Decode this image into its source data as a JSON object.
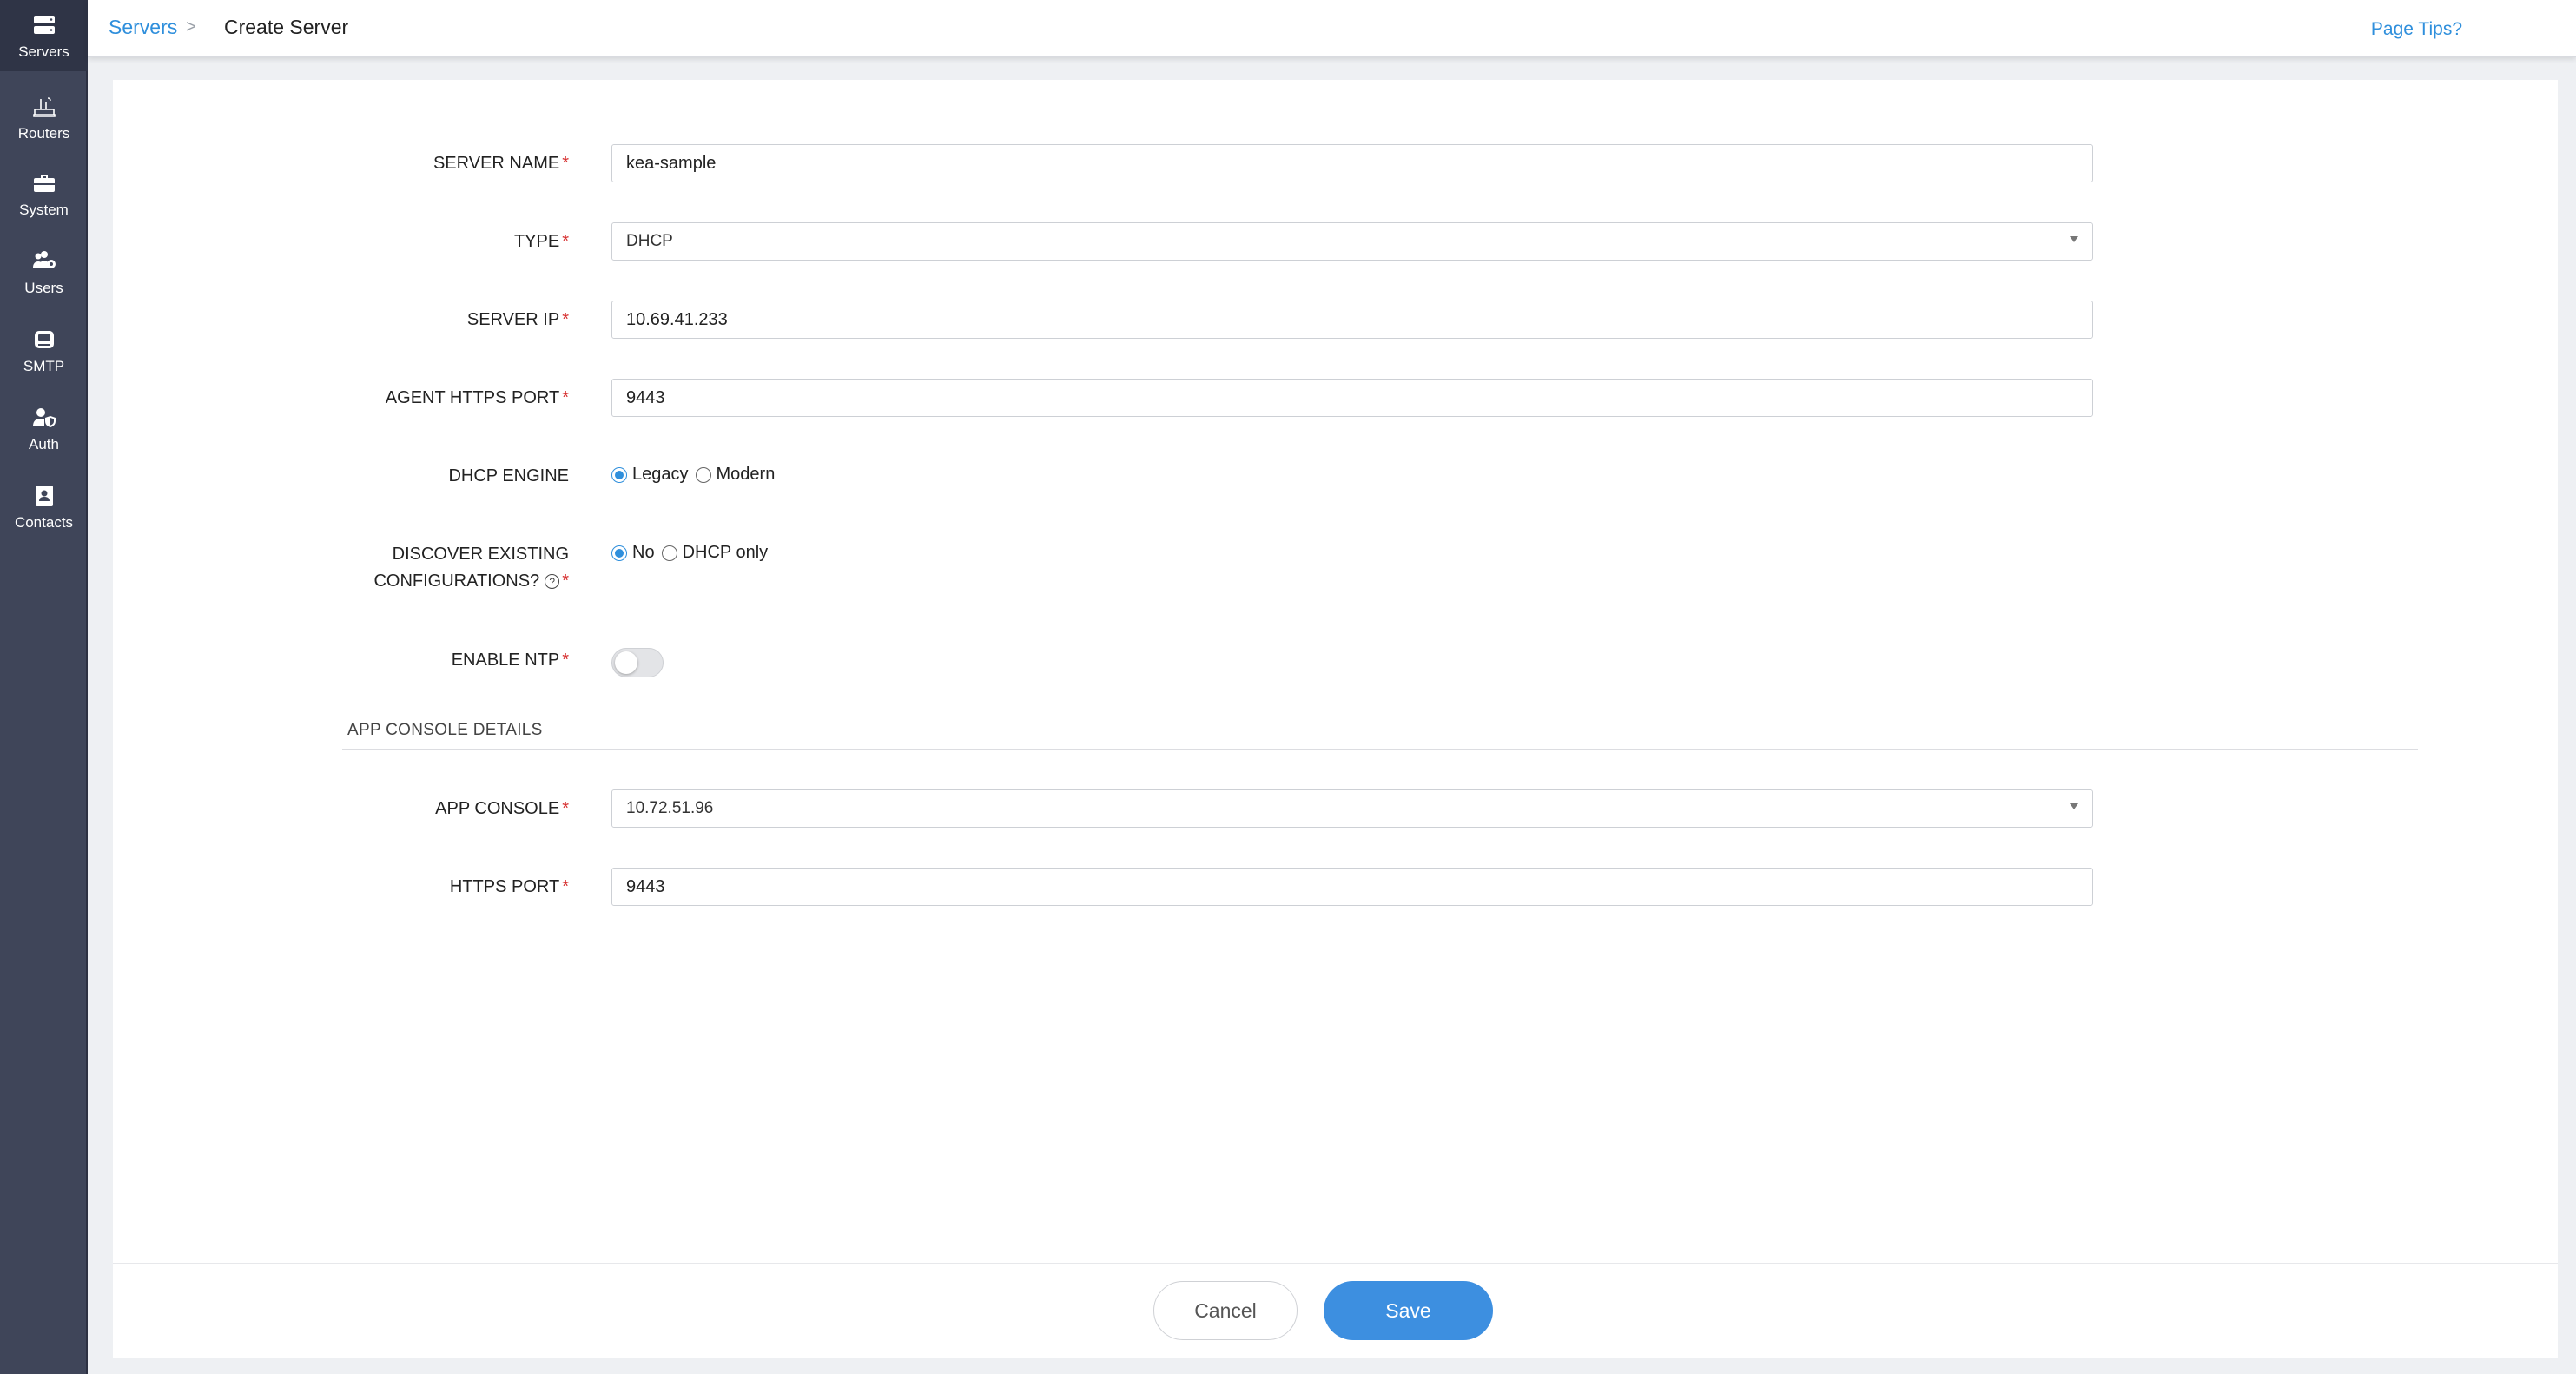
{
  "sidebar": {
    "items": [
      {
        "label": "Servers",
        "icon": "server-icon",
        "active": true
      },
      {
        "label": "Routers",
        "icon": "router-icon"
      },
      {
        "label": "System",
        "icon": "toolbox-icon"
      },
      {
        "label": "Users",
        "icon": "users-cog-icon"
      },
      {
        "label": "SMTP",
        "icon": "inbox-icon"
      },
      {
        "label": "Auth",
        "icon": "user-shield-icon"
      },
      {
        "label": "Contacts",
        "icon": "address-book-icon"
      }
    ]
  },
  "header": {
    "breadcrumb_link": "Servers",
    "breadcrumb_separator": ">",
    "breadcrumb_current": "Create Server",
    "page_tips": "Page Tips?"
  },
  "form": {
    "server_name": {
      "label": "SERVER NAME",
      "value": "kea-sample"
    },
    "type": {
      "label": "TYPE",
      "value": "DHCP"
    },
    "server_ip": {
      "label": "SERVER IP",
      "value": "10.69.41.233"
    },
    "agent_https_port": {
      "label": "AGENT HTTPS PORT",
      "value": "9443"
    },
    "dhcp_engine": {
      "label": "DHCP ENGINE",
      "options": [
        "Legacy",
        "Modern"
      ],
      "selected": "Legacy"
    },
    "discover": {
      "label_line1": "DISCOVER EXISTING",
      "label_line2": "CONFIGURATIONS?",
      "help_symbol": "?",
      "options": [
        "No",
        "DHCP only"
      ],
      "selected": "No"
    },
    "enable_ntp": {
      "label": "ENABLE NTP",
      "enabled": false
    },
    "required_marker": "*"
  },
  "app_console_section": {
    "title": "APP CONSOLE DETAILS",
    "app_console": {
      "label": "APP CONSOLE",
      "value": "10.72.51.96"
    },
    "https_port": {
      "label": "HTTPS PORT",
      "value": "9443"
    }
  },
  "footer": {
    "cancel_label": "Cancel",
    "save_label": "Save"
  },
  "colors": {
    "sidebar": "#3f4559",
    "accent": "#2f8fdc",
    "save_button": "#3d8fe0",
    "required": "#d62d2d"
  }
}
